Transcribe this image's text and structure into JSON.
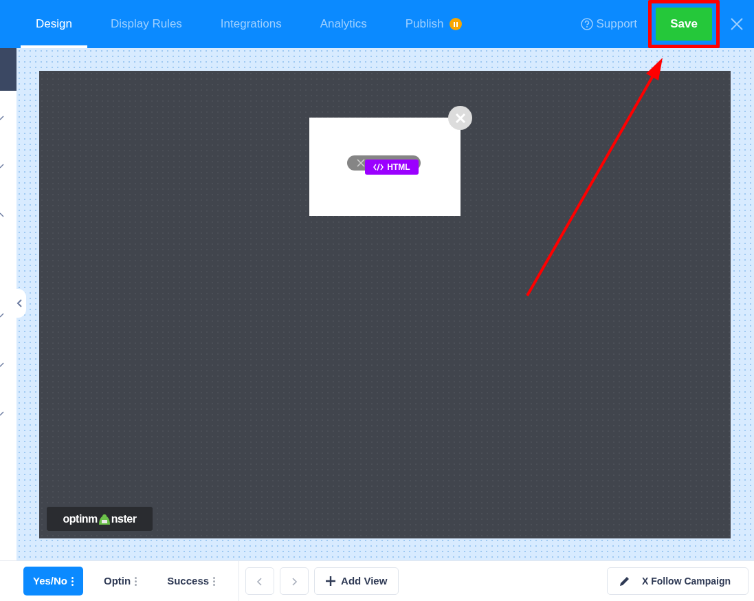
{
  "tabs": [
    {
      "label": "Design",
      "selected": true
    },
    {
      "label": "Display Rules",
      "selected": false
    },
    {
      "label": "Integrations",
      "selected": false
    },
    {
      "label": "Analytics",
      "selected": false
    },
    {
      "label": "Publish",
      "selected": false,
      "paused": true
    }
  ],
  "support": {
    "label": "Support"
  },
  "save": {
    "label": "Save",
    "highlighted": true
  },
  "popup": {
    "badge": "HTML"
  },
  "brand": {
    "before": "optinm",
    "after": "nster"
  },
  "views": [
    {
      "label": "Yes/No",
      "selected": true
    },
    {
      "label": "Optin",
      "selected": false
    },
    {
      "label": "Success",
      "selected": false
    }
  ],
  "add_view": {
    "label": "Add View"
  },
  "campaign": {
    "label": "X Follow Campaign"
  }
}
